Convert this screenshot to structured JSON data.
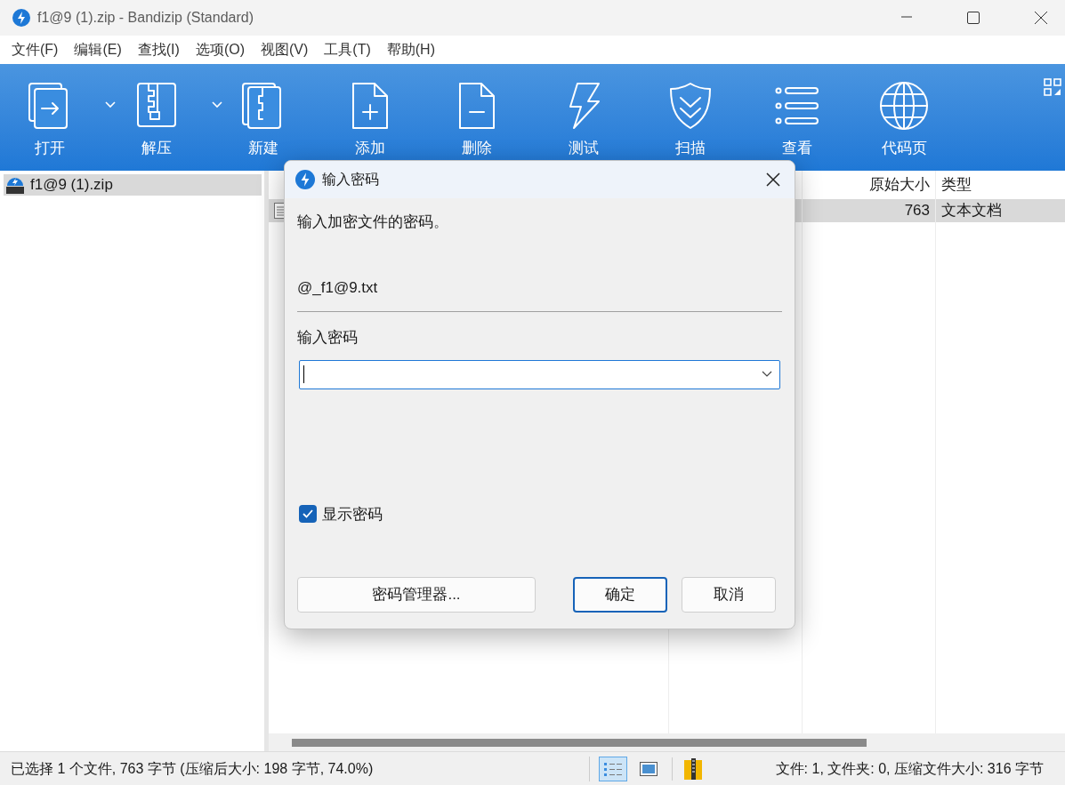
{
  "window": {
    "title": "f1@9 (1).zip - Bandizip (Standard)"
  },
  "menu": [
    "文件(F)",
    "编辑(E)",
    "查找(I)",
    "选项(O)",
    "视图(V)",
    "工具(T)",
    "帮助(H)"
  ],
  "toolbar": [
    {
      "label": "打开",
      "dropdown": true
    },
    {
      "label": "解压",
      "dropdown": true
    },
    {
      "label": "新建",
      "dropdown": false
    },
    {
      "label": "添加",
      "dropdown": false
    },
    {
      "label": "删除",
      "dropdown": false
    },
    {
      "label": "测试",
      "dropdown": false
    },
    {
      "label": "扫描",
      "dropdown": false
    },
    {
      "label": "查看",
      "dropdown": false
    },
    {
      "label": "代码页",
      "dropdown": false
    }
  ],
  "tree": [
    {
      "label": "f1@9 (1).zip",
      "selected": true
    }
  ],
  "file_list": {
    "columns": [
      "原始大小",
      "类型"
    ],
    "rows": [
      {
        "size": "763",
        "type": "文本文档",
        "selected": true
      }
    ]
  },
  "dialog": {
    "title": "输入密码",
    "message": "输入加密文件的密码。",
    "file_name": "@_f1@9.txt",
    "field_label": "输入密码",
    "show_password": {
      "label": "显示密码",
      "checked": true
    },
    "buttons": [
      {
        "label": "密码管理器...",
        "default": false
      },
      {
        "label": "确定",
        "default": true
      },
      {
        "label": "取消",
        "default": false
      }
    ]
  },
  "status_bar": {
    "left": "已选择 1 个文件, 763 字节 (压缩后大小: 198 字节, 74.0%)",
    "right": "文件: 1, 文件夹: 0, 压缩文件大小: 316 字节",
    "views": [
      {
        "selected": true
      },
      {
        "selected": false
      }
    ]
  }
}
